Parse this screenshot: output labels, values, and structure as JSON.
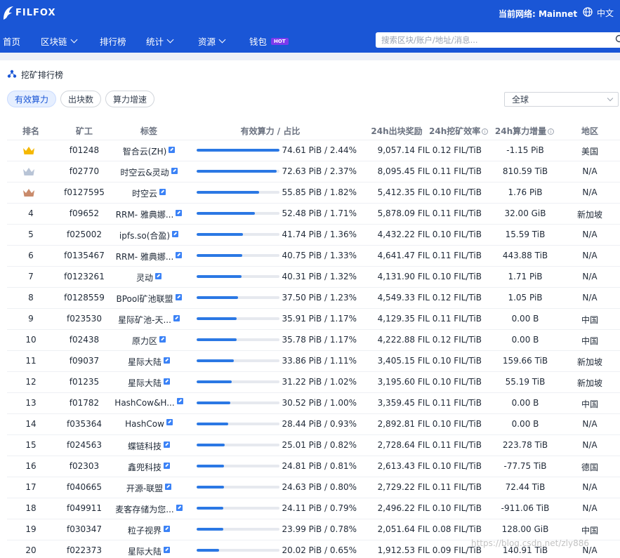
{
  "header": {
    "logo_text": "FILFOX",
    "network_label": "当前网络: Mainnet",
    "language_label": "中文",
    "nav": [
      {
        "label": "首页",
        "has_dropdown": false
      },
      {
        "label": "区块链",
        "has_dropdown": true
      },
      {
        "label": "排行榜",
        "has_dropdown": false
      },
      {
        "label": "统计",
        "has_dropdown": true
      },
      {
        "label": "资源",
        "has_dropdown": true
      },
      {
        "label": "钱包",
        "has_dropdown": false,
        "badge": "HOT"
      }
    ],
    "search_placeholder": "搜索区块/账户/地址/消息..."
  },
  "page": {
    "title": "挖矿排行榜",
    "tabs": [
      {
        "label": "有效算力",
        "active": true
      },
      {
        "label": "出块数",
        "active": false
      },
      {
        "label": "算力增速",
        "active": false
      }
    ],
    "region_selected": "全球"
  },
  "table": {
    "headers": {
      "rank": "排名",
      "miner": "矿工",
      "tag": "标签",
      "power": "有效算力 / 占比",
      "reward": "24h出块奖励",
      "efficiency": "24h挖矿效率",
      "increase": "24h算力增量",
      "region": "地区"
    },
    "rows": [
      {
        "rank": "",
        "crown": "gold",
        "miner": "f01248",
        "tag": "智合云(ZH)",
        "power": "74.61 PiB / 2.44%",
        "share": 1.0,
        "reward": "9,057.14 FIL",
        "efficiency": "0.12 FIL/TiB",
        "increase": "-1.15 PiB",
        "region": "美国"
      },
      {
        "rank": "",
        "crown": "silver",
        "miner": "f02770",
        "tag": "时空云&灵动",
        "power": "72.63 PiB / 2.37%",
        "share": 0.97,
        "reward": "8,095.45 FIL",
        "efficiency": "0.11 FIL/TiB",
        "increase": "810.59 TiB",
        "region": "N/A"
      },
      {
        "rank": "",
        "crown": "bronze",
        "miner": "f0127595",
        "tag": "时空云",
        "power": "55.85 PiB / 1.82%",
        "share": 0.75,
        "reward": "5,412.35 FIL",
        "efficiency": "0.10 FIL/TiB",
        "increase": "1.76 PiB",
        "region": "N/A"
      },
      {
        "rank": "4",
        "crown": "",
        "miner": "f09652",
        "tag": "RRM- 雅典娜...",
        "power": "52.48 PiB / 1.71%",
        "share": 0.7,
        "reward": "5,878.09 FIL",
        "efficiency": "0.11 FIL/TiB",
        "increase": "32.00 GiB",
        "region": "新加坡"
      },
      {
        "rank": "5",
        "crown": "",
        "miner": "f025002",
        "tag": "ipfs.so(合盈)",
        "power": "41.74 PiB / 1.36%",
        "share": 0.56,
        "reward": "4,432.22 FIL",
        "efficiency": "0.10 FIL/TiB",
        "increase": "15.59 TiB",
        "region": "N/A"
      },
      {
        "rank": "6",
        "crown": "",
        "miner": "f0135467",
        "tag": "RRM- 雅典娜...",
        "power": "40.75 PiB / 1.33%",
        "share": 0.55,
        "reward": "4,641.47 FIL",
        "efficiency": "0.11 FIL/TiB",
        "increase": "443.88 TiB",
        "region": "N/A"
      },
      {
        "rank": "7",
        "crown": "",
        "miner": "f0123261",
        "tag": "灵动",
        "power": "40.31 PiB / 1.32%",
        "share": 0.54,
        "reward": "4,131.90 FIL",
        "efficiency": "0.10 FIL/TiB",
        "increase": "1.71 PiB",
        "region": "N/A"
      },
      {
        "rank": "8",
        "crown": "",
        "miner": "f0128559",
        "tag": "BPool矿池联盟",
        "power": "37.50 PiB / 1.23%",
        "share": 0.5,
        "reward": "4,549.33 FIL",
        "efficiency": "0.12 FIL/TiB",
        "increase": "1.05 PiB",
        "region": "N/A"
      },
      {
        "rank": "9",
        "crown": "",
        "miner": "f023530",
        "tag": "星际矿池-天...",
        "power": "35.91 PiB / 1.17%",
        "share": 0.48,
        "reward": "4,129.35 FIL",
        "efficiency": "0.11 FIL/TiB",
        "increase": "0.00 B",
        "region": "中国"
      },
      {
        "rank": "10",
        "crown": "",
        "miner": "f02438",
        "tag": "原力区",
        "power": "35.78 PiB / 1.17%",
        "share": 0.48,
        "reward": "4,222.88 FIL",
        "efficiency": "0.12 FIL/TiB",
        "increase": "0.00 B",
        "region": "中国"
      },
      {
        "rank": "11",
        "crown": "",
        "miner": "f09037",
        "tag": "星际大陆",
        "power": "33.86 PiB / 1.11%",
        "share": 0.45,
        "reward": "3,405.15 FIL",
        "efficiency": "0.10 FIL/TiB",
        "increase": "159.66 TiB",
        "region": "新加坡"
      },
      {
        "rank": "12",
        "crown": "",
        "miner": "f01235",
        "tag": "星际大陆",
        "power": "31.22 PiB / 1.02%",
        "share": 0.42,
        "reward": "3,195.60 FIL",
        "efficiency": "0.10 FIL/TiB",
        "increase": "55.19 TiB",
        "region": "新加坡"
      },
      {
        "rank": "13",
        "crown": "",
        "miner": "f01782",
        "tag": "HashCow&H...",
        "power": "30.52 PiB / 1.00%",
        "share": 0.41,
        "reward": "3,359.45 FIL",
        "efficiency": "0.11 FIL/TiB",
        "increase": "0.00 B",
        "region": "中国"
      },
      {
        "rank": "14",
        "crown": "",
        "miner": "f035364",
        "tag": "HashCow",
        "power": "28.44 PiB / 0.93%",
        "share": 0.38,
        "reward": "2,892.81 FIL",
        "efficiency": "0.10 FIL/TiB",
        "increase": "0.00 B",
        "region": "N/A"
      },
      {
        "rank": "15",
        "crown": "",
        "miner": "f024563",
        "tag": "蝶链科技",
        "power": "25.01 PiB / 0.82%",
        "share": 0.34,
        "reward": "2,728.64 FIL",
        "efficiency": "0.11 FIL/TiB",
        "increase": "223.78 TiB",
        "region": "N/A"
      },
      {
        "rank": "16",
        "crown": "",
        "miner": "f02303",
        "tag": "鑫兜科技",
        "power": "24.81 PiB / 0.81%",
        "share": 0.33,
        "reward": "2,613.43 FIL",
        "efficiency": "0.10 FIL/TiB",
        "increase": "-77.75 TiB",
        "region": "德国"
      },
      {
        "rank": "17",
        "crown": "",
        "miner": "f040665",
        "tag": "开源-联盟",
        "power": "24.63 PiB / 0.80%",
        "share": 0.33,
        "reward": "2,729.22 FIL",
        "efficiency": "0.11 FIL/TiB",
        "increase": "72.44 TiB",
        "region": "N/A"
      },
      {
        "rank": "18",
        "crown": "",
        "miner": "f049911",
        "tag": "麦客存储为您...",
        "power": "24.11 PiB / 0.79%",
        "share": 0.32,
        "reward": "2,496.22 FIL",
        "efficiency": "0.10 FIL/TiB",
        "increase": "-911.06 TiB",
        "region": "N/A"
      },
      {
        "rank": "19",
        "crown": "",
        "miner": "f030347",
        "tag": "粒子视界",
        "power": "23.99 PiB / 0.78%",
        "share": 0.32,
        "reward": "2,051.64 FIL",
        "efficiency": "0.08 FIL/TiB",
        "increase": "128.00 GiB",
        "region": "中国"
      },
      {
        "rank": "20",
        "crown": "",
        "miner": "f022373",
        "tag": "星际大陆",
        "power": "20.02 PiB / 0.65%",
        "share": 0.27,
        "reward": "1,912.53 FIL",
        "efficiency": "0.09 FIL/TiB",
        "increase": "140.91 TiB",
        "region": "N/A"
      }
    ]
  },
  "watermark": "https://blog.csdn.net/zly886",
  "colors": {
    "brand": "#1a56d6",
    "bar": "#2b78e4",
    "gold": "#f5b800",
    "silver": "#b8c4d6",
    "bronze": "#c98a6b"
  }
}
